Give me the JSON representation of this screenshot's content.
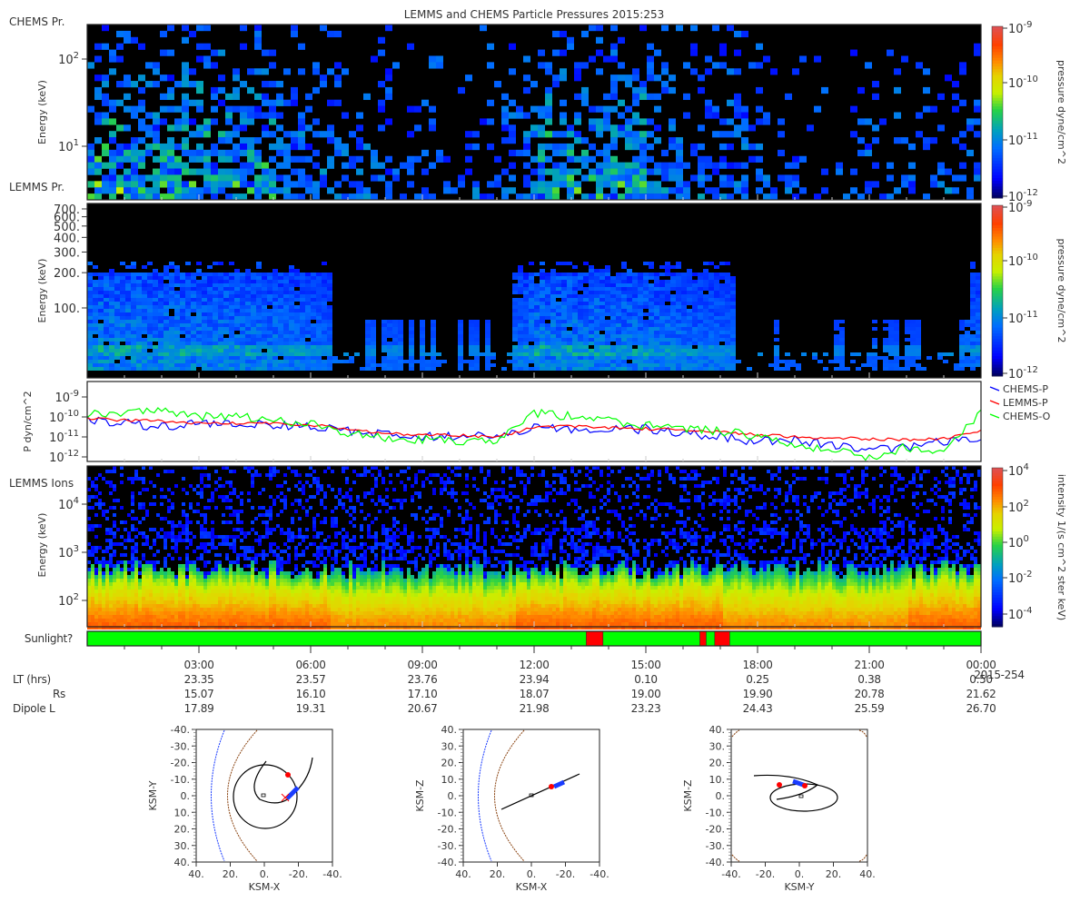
{
  "title": "LEMMS and CHEMS Particle Pressures  2015:253",
  "colors": {
    "blue": "#0000ff",
    "red": "#ff0000",
    "green": "#00ff00",
    "sun_yes": "#00ff00",
    "sun_no": "#ff0000",
    "orbit_blue": "#1a3cff",
    "orbit_brown": "#8b4513"
  },
  "chart_data": [
    {
      "type": "heatmap",
      "panel_label": "CHEMS Pr.",
      "ylabel": "Energy (keV)",
      "yscale": "log",
      "ylim": [
        4,
        250
      ],
      "yticks": [
        {
          "base": "10",
          "exp": "2",
          "value": 100
        },
        {
          "base": "10",
          "exp": "1",
          "value": 10
        }
      ],
      "colorbar": {
        "label": "pressure dyne/cm^2",
        "scale": "log",
        "range": [
          1e-12,
          1e-09
        ],
        "ticks": [
          {
            "base": "10",
            "exp": "-9"
          },
          {
            "base": "10",
            "exp": "-10"
          },
          {
            "base": "10",
            "exp": "-11"
          },
          {
            "base": "10",
            "exp": "-12"
          }
        ]
      },
      "relative_activity_by_hour": [
        0.9,
        0.95,
        0.9,
        0.85,
        0.8,
        0.7,
        0.6,
        0.45,
        0.4,
        0.35,
        0.3,
        0.35,
        0.85,
        0.85,
        0.8,
        0.75,
        0.6,
        0.55,
        0.45,
        0.3,
        0.25,
        0.3,
        0.35,
        0.4,
        0.4
      ]
    },
    {
      "type": "heatmap",
      "panel_label": "LEMMS Pr.",
      "ylabel": "Energy (keV)",
      "yscale": "log",
      "ylim": [
        25,
        780
      ],
      "yticks": [
        {
          "label": "700.",
          "value": 700
        },
        {
          "label": "600.",
          "value": 600
        },
        {
          "label": "500.",
          "value": 500
        },
        {
          "label": "400.",
          "value": 400
        },
        {
          "label": "300.",
          "value": 300
        },
        {
          "label": "200.",
          "value": 200
        },
        {
          "label": "100.",
          "value": 100
        }
      ],
      "colorbar": {
        "label": "pressure dyne/cm^2",
        "scale": "log",
        "range": [
          1e-12,
          1e-09
        ],
        "ticks": [
          {
            "base": "10",
            "exp": "-9"
          },
          {
            "base": "10",
            "exp": "-10"
          },
          {
            "base": "10",
            "exp": "-11"
          },
          {
            "base": "10",
            "exp": "-12"
          }
        ]
      },
      "relative_activity_by_hour": [
        0.9,
        0.9,
        0.85,
        0.8,
        0.75,
        0.7,
        0.55,
        0.25,
        0.3,
        0.2,
        0.15,
        0.1,
        0.9,
        0.85,
        0.8,
        0.75,
        0.6,
        0.5,
        0.2,
        0.1,
        0.15,
        0.1,
        0.1,
        0.2,
        0.55
      ]
    },
    {
      "type": "line",
      "ylabel": "P dyn/cm^2",
      "yscale": "log",
      "ylim": [
        5.9e-13,
        5.9e-09
      ],
      "yticks": [
        {
          "base": "10",
          "exp": "-9"
        },
        {
          "base": "10",
          "exp": "-10"
        },
        {
          "base": "10",
          "exp": "-11"
        },
        {
          "base": "10",
          "exp": "-12"
        }
      ],
      "legend_position": "right",
      "x_hours": [
        0,
        1,
        2,
        3,
        4,
        5,
        6,
        7,
        8,
        9,
        10,
        11,
        12,
        13,
        14,
        15,
        16,
        17,
        18,
        19,
        20,
        21,
        22,
        23,
        24
      ],
      "series": [
        {
          "name": "CHEMS-P",
          "color": "#0000ff",
          "values": [
            8e-11,
            5e-11,
            3e-11,
            5e-11,
            4e-11,
            4e-11,
            3.5e-11,
            2e-11,
            1.2e-11,
            1e-11,
            1.1e-11,
            1e-11,
            3e-11,
            2.5e-11,
            2.2e-11,
            2.5e-11,
            1.6e-11,
            1e-11,
            6e-12,
            7e-12,
            4e-12,
            2e-12,
            3e-12,
            6e-12,
            7e-12
          ]
        },
        {
          "name": "LEMMS-P",
          "color": "#ff0000",
          "values": [
            8e-11,
            7e-11,
            6e-11,
            5e-11,
            5e-11,
            4.5e-11,
            4e-11,
            2.5e-11,
            1.5e-11,
            1.3e-11,
            1.2e-11,
            1e-11,
            3e-11,
            3.5e-11,
            3e-11,
            2.6e-11,
            2.2e-11,
            1.8e-11,
            1.3e-11,
            1e-11,
            9e-12,
            8e-12,
            7e-12,
            8e-12,
            2e-11
          ]
        },
        {
          "name": "CHEMS-O",
          "color": "#00ff00",
          "values": [
            1.4e-10,
            1.6e-10,
            1.8e-10,
            1e-10,
            1.2e-10,
            6e-11,
            5e-11,
            1.5e-11,
            1e-11,
            7e-12,
            6e-12,
            5e-12,
            1.5e-10,
            1.1e-10,
            6e-11,
            4e-11,
            3e-11,
            2e-11,
            1e-11,
            5e-12,
            2e-12,
            1e-12,
            3e-12,
            2e-12,
            1.5e-10
          ]
        }
      ]
    },
    {
      "type": "heatmap",
      "panel_label": "LEMMS Ions",
      "ylabel": "Energy (keV)",
      "yscale": "log",
      "ylim": [
        28,
        80000
      ],
      "yticks": [
        {
          "base": "10",
          "exp": "4",
          "value": 10000
        },
        {
          "base": "10",
          "exp": "3",
          "value": 1000
        },
        {
          "base": "10",
          "exp": "2",
          "value": 100
        }
      ],
      "colorbar": {
        "label": "intensity 1/(s cm^2 ster keV)",
        "scale": "log",
        "range": [
          1e-05,
          10000.0
        ],
        "ticks": [
          {
            "base": "10",
            "exp": "4"
          },
          {
            "base": "10",
            "exp": "2"
          },
          {
            "base": "10",
            "exp": "0"
          },
          {
            "base": "10",
            "exp": "-2"
          },
          {
            "base": "10",
            "exp": "-4"
          }
        ]
      }
    },
    {
      "type": "bar",
      "label": "Sunlight?",
      "in_shadow_intervals_hours": [
        [
          13.4,
          13.85
        ],
        [
          16.45,
          16.62
        ],
        [
          16.85,
          17.25
        ]
      ]
    }
  ],
  "time_axis": {
    "ticks": [
      "03:00",
      "06:00",
      "09:00",
      "12:00",
      "15:00",
      "18:00",
      "21:00",
      "00:00"
    ],
    "end_date": "2015-254",
    "rows": [
      {
        "label": "LT (hrs)",
        "values": [
          "23.35",
          "23.57",
          "23.76",
          "23.94",
          "0.10",
          "0.25",
          "0.38",
          "0.50"
        ]
      },
      {
        "label": "Rs",
        "values": [
          "15.07",
          "16.10",
          "17.10",
          "18.07",
          "19.00",
          "19.90",
          "20.78",
          "21.62"
        ]
      },
      {
        "label": "Dipole L",
        "values": [
          "17.89",
          "19.31",
          "20.67",
          "21.98",
          "23.23",
          "24.43",
          "25.59",
          "26.70"
        ]
      }
    ]
  },
  "orbit_plots": [
    {
      "xlabel": "KSM-X",
      "ylabel": "KSM-Y",
      "xticks": [
        "40.",
        "20.",
        "0.",
        "-20.",
        "-40."
      ],
      "yticks": [
        "-40.",
        "-30.",
        "-20.",
        "-10.",
        "0.",
        "10.",
        "20.",
        "30.",
        "40."
      ]
    },
    {
      "xlabel": "KSM-X",
      "ylabel": "KSM-Z",
      "xticks": [
        "40.",
        "20.",
        "0.",
        "-20.",
        "-40."
      ],
      "yticks": [
        "40.",
        "30.",
        "20.",
        "10.",
        "0.",
        "-10.",
        "-20.",
        "-30.",
        "-40."
      ]
    },
    {
      "xlabel": "KSM-Y",
      "ylabel": "KSM-Z",
      "xticks": [
        "-40.",
        "-20.",
        "0.",
        "20.",
        "40."
      ],
      "yticks": [
        "40.",
        "30.",
        "20.",
        "10.",
        "0.",
        "-10.",
        "-20.",
        "-30.",
        "-40."
      ]
    }
  ]
}
